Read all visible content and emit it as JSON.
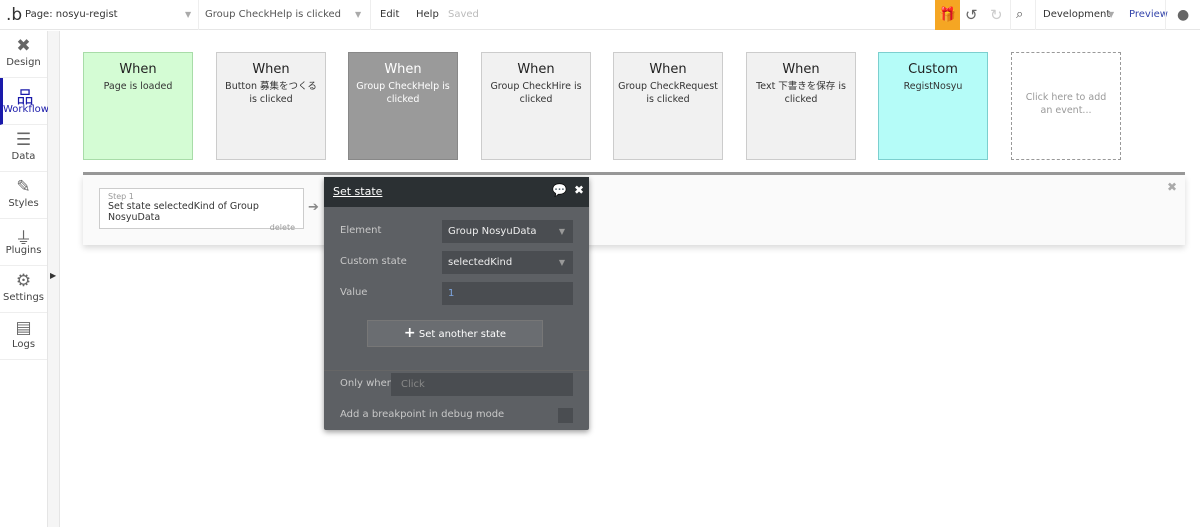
{
  "topbar": {
    "logo": ".b",
    "page": "Page: nosyu-regist",
    "event": "Group CheckHelp is clicked",
    "edit": "Edit",
    "help": "Help",
    "saved": "Saved",
    "environment": "Development",
    "preview": "Preview",
    "accent": "#f5a623"
  },
  "sidebar": {
    "items": [
      {
        "label": "Design",
        "icon": "design-icon"
      },
      {
        "label": "Workflow",
        "icon": "workflow-icon"
      },
      {
        "label": "Data",
        "icon": "database-icon"
      },
      {
        "label": "Styles",
        "icon": "brush-icon"
      },
      {
        "label": "Plugins",
        "icon": "plug-icon"
      },
      {
        "label": "Settings",
        "icon": "gear-icon"
      },
      {
        "label": "Logs",
        "icon": "document-icon"
      }
    ],
    "active": "Workflow"
  },
  "events": [
    {
      "head": "When",
      "desc": "Page is loaded",
      "color": "#d4fcd4"
    },
    {
      "head": "When",
      "desc": "Button 募集をつくる is clicked",
      "color": "#f1f1f1"
    },
    {
      "head": "When",
      "desc": "Group CheckHelp is clicked",
      "color": "#9a9a9a"
    },
    {
      "head": "When",
      "desc": "Group CheckHire is clicked",
      "color": "#f1f1f1"
    },
    {
      "head": "When",
      "desc": "Group CheckRequest is clicked",
      "color": "#f1f1f1"
    },
    {
      "head": "When",
      "desc": "Text 下書きを保存 is clicked",
      "color": "#f1f1f1"
    },
    {
      "head": "Custom",
      "desc": "RegistNosyu",
      "color": "#b5fcf8"
    }
  ],
  "add_event": "Click here to add an event...",
  "step": {
    "label": "Step 1",
    "text": "Set state selectedKind of Group NosyuData",
    "delete": "delete"
  },
  "popup": {
    "title": "Set state",
    "element_label": "Element",
    "element_value": "Group NosyuData",
    "state_label": "Custom state",
    "state_value": "selectedKind",
    "value_label": "Value",
    "value": "1",
    "another": "Set another state",
    "only_when_label": "Only when",
    "only_when_placeholder": "Click",
    "breakpoint_label": "Add a breakpoint in debug mode"
  }
}
